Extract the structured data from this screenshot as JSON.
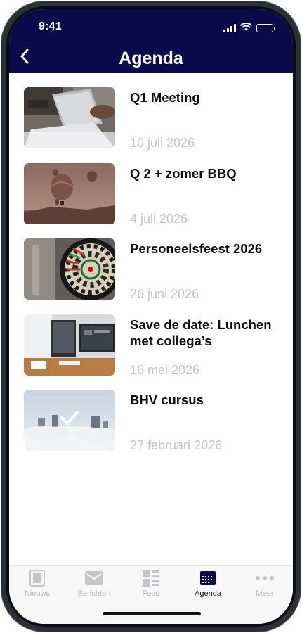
{
  "status_bar": {
    "time": "9:41"
  },
  "header": {
    "title": "Agenda",
    "bg_color": "#0a0a4a",
    "back_icon": "chevron-left-icon"
  },
  "agenda": {
    "items": [
      {
        "title": "Q1 Meeting",
        "date": "10 juli 2026",
        "image": "laptop-meeting-photo"
      },
      {
        "title": "Q 2 + zomer BBQ",
        "date": "4 juli 2026",
        "image": "hot-air-balloons-photo"
      },
      {
        "title": "Personeelsfeest 2026",
        "date": "26 juni 2026",
        "image": "dartboard-photo"
      },
      {
        "title": "Save de date: Lunchen met collega’s",
        "date": "16 mei 2026",
        "image": "office-desk-photo"
      },
      {
        "title": "BHV cursus",
        "date": "27 februari 2026",
        "image": "city-fog-photo",
        "completed": true
      }
    ]
  },
  "tabbar": {
    "tabs": [
      {
        "label": "Nieuws",
        "icon": "newspaper-icon",
        "active": false
      },
      {
        "label": "Berichten",
        "icon": "envelope-icon",
        "active": false
      },
      {
        "label": "Feed",
        "icon": "feed-icon",
        "active": false
      },
      {
        "label": "Agenda",
        "icon": "calendar-icon",
        "active": true
      },
      {
        "label": "Meer",
        "icon": "more-icon",
        "active": false
      }
    ]
  }
}
